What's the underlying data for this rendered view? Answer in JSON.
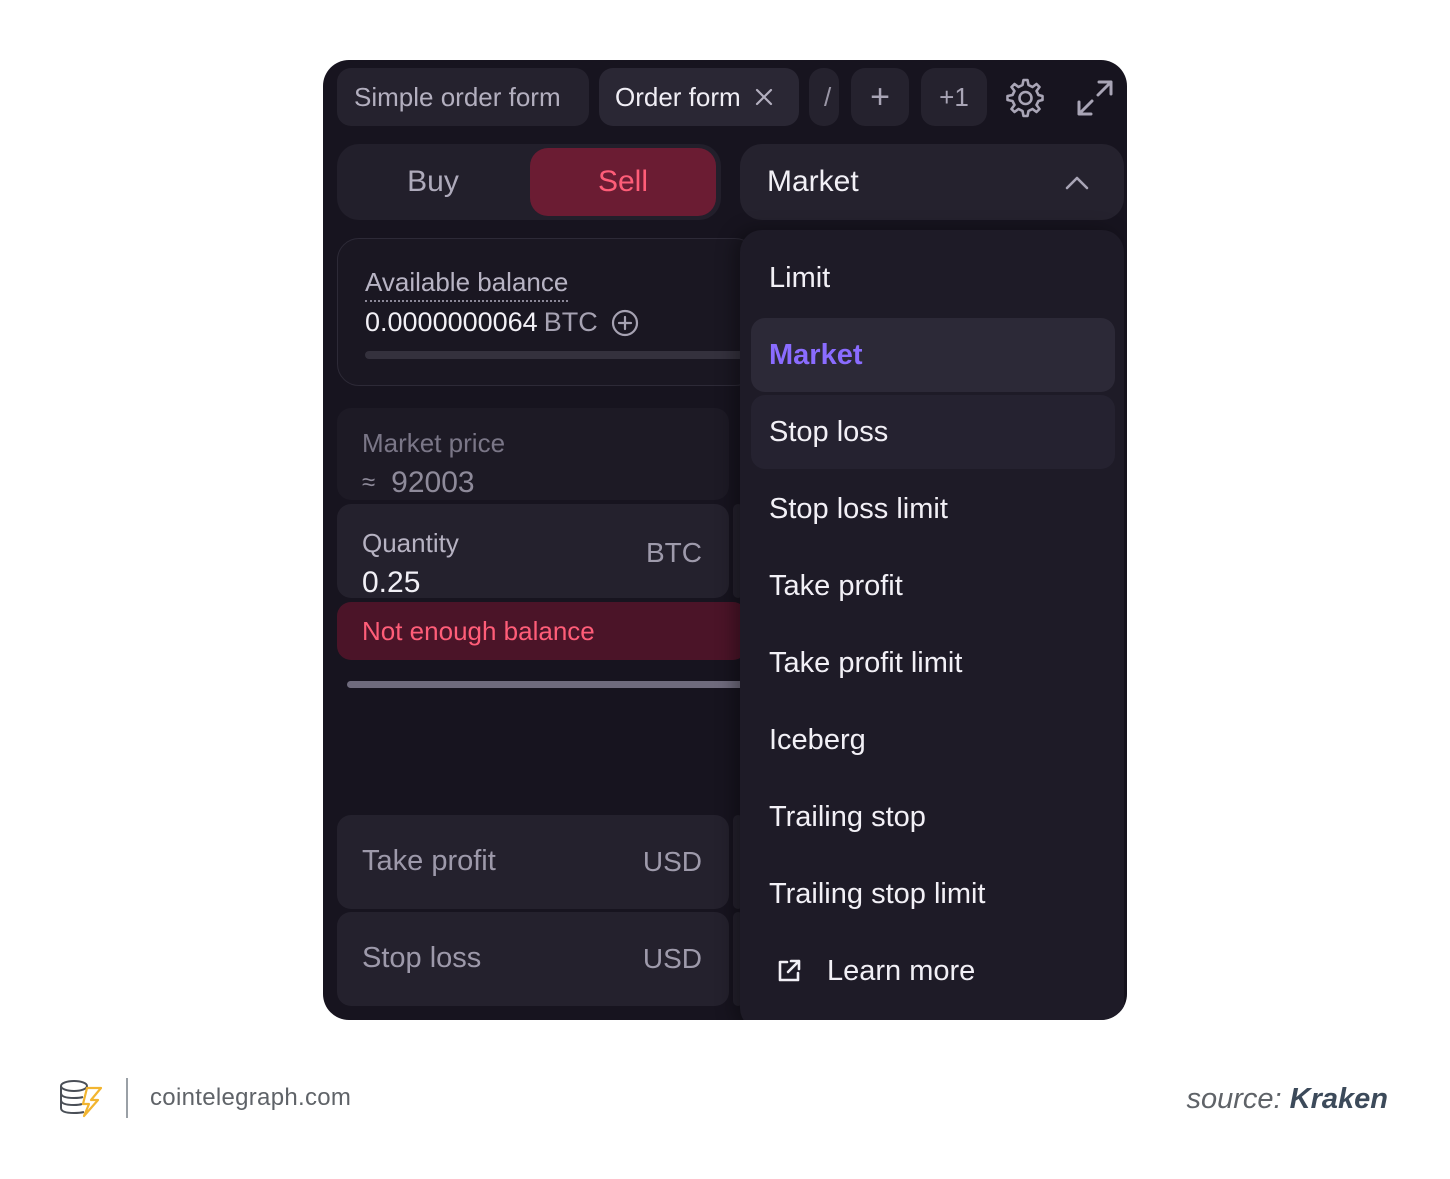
{
  "tabs": {
    "simple": "Simple order form",
    "order": "Order form",
    "cut": "/",
    "plus": "+",
    "plus_one": "+1"
  },
  "side_toggle": {
    "buy": "Buy",
    "sell": "Sell"
  },
  "order_type": {
    "selected": "Market"
  },
  "balance": {
    "label": "Available balance",
    "value": "0.0000000064",
    "unit": "BTC"
  },
  "market_price": {
    "label": "Market price",
    "approx": "≈",
    "value": "92003"
  },
  "quantity": {
    "label": "Quantity",
    "value": "0.25",
    "unit": "BTC"
  },
  "error": "Not enough balance",
  "take_profit": {
    "label": "Take profit",
    "unit": "USD"
  },
  "stop_loss": {
    "label": "Stop loss",
    "unit": "USD"
  },
  "menu": {
    "items": [
      "Limit",
      "Market",
      "Stop loss",
      "Stop loss limit",
      "Take profit",
      "Take profit limit",
      "Iceberg",
      "Trailing stop",
      "Trailing stop limit"
    ],
    "learn_more": "Learn more"
  },
  "footer": {
    "site": "cointelegraph.com",
    "source_prefix": "source:",
    "source_name": "Kraken"
  },
  "colors": {
    "panel_bg": "#17141f",
    "sell_accent": "#ff5d78",
    "selected_accent": "#8a6cff"
  },
  "icons": [
    "close-icon",
    "plus-icon",
    "gear-icon",
    "expand-icon",
    "chevron-up-icon",
    "plus-circle-icon",
    "external-link-icon",
    "cointelegraph-logo-icon"
  ]
}
